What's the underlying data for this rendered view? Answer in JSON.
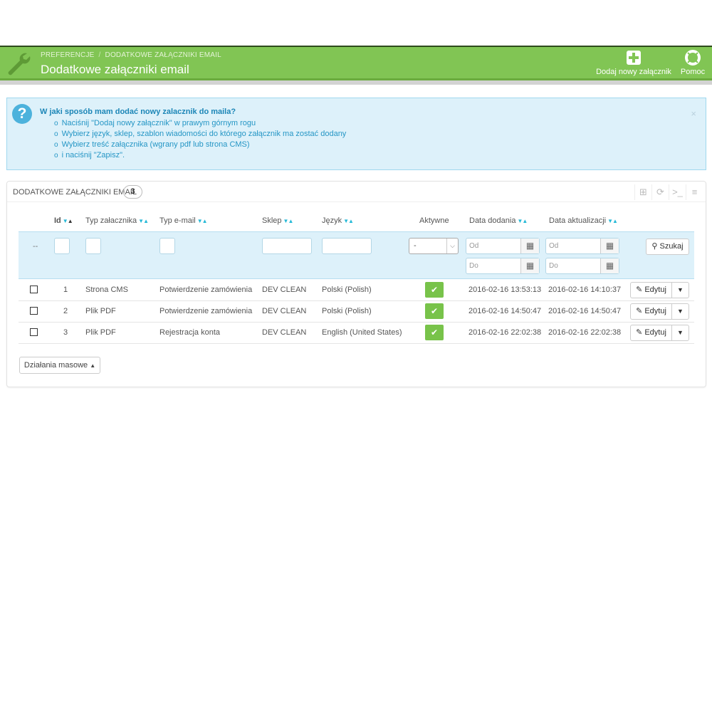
{
  "header": {
    "breadcrumb": [
      "PREFERENCJE",
      "DODATKOWE ZAŁĄCZNIKI EMAIL"
    ],
    "title": "Dodatkowe załączniki email",
    "add_label": "Dodaj nowy załącznik",
    "help_label": "Pomoc",
    "bar_color": "#81c554"
  },
  "alert": {
    "title": "W jaki sposób mam dodać nowy zalacznik do maila?",
    "items": [
      "Naciśnij \"Dodaj nowy załącznik\" w prawym górnym rogu",
      "Wybierz język, sklep, szablon wiadomości do którego załącznik ma zostać dodany",
      "Wybierz treść załącznika (wgrany pdf lub strona CMS)",
      "i naciśnij \"Zapisz\"."
    ],
    "close": "×"
  },
  "panel": {
    "title": "DODATKOWE ZAŁĄCZNIKI EMAIL",
    "count": "3",
    "columns": {
      "id": "Id",
      "type": "Typ załacznika",
      "email_type": "Typ e-mail",
      "shop": "Sklep",
      "lang": "Język",
      "active": "Aktywne",
      "date_add": "Data dodania",
      "date_upd": "Data aktualizacji"
    },
    "filters": {
      "dash": "--",
      "active_select": "-",
      "from_placeholder": "Od",
      "to_placeholder": "Do",
      "search_label": "Szukaj"
    },
    "rows": [
      {
        "id": "1",
        "type": "Strona CMS",
        "email_type": "Potwierdzenie zamówienia",
        "shop": "DEV CLEAN",
        "lang": "Polski (Polish)",
        "active": true,
        "date_add": "2016-02-16 13:53:13",
        "date_upd": "2016-02-16 14:10:37"
      },
      {
        "id": "2",
        "type": "Plik PDF",
        "email_type": "Potwierdzenie zamówienia",
        "shop": "DEV CLEAN",
        "lang": "Polski (Polish)",
        "active": true,
        "date_add": "2016-02-16 14:50:47",
        "date_upd": "2016-02-16 14:50:47"
      },
      {
        "id": "3",
        "type": "Plik PDF",
        "email_type": "Rejestracja konta",
        "shop": "DEV CLEAN",
        "lang": "English (United States)",
        "active": true,
        "date_add": "2016-02-16 22:02:38",
        "date_upd": "2016-02-16 22:02:38"
      }
    ],
    "edit_label": "Edytuj",
    "bulk_label": "Działania masowe"
  }
}
